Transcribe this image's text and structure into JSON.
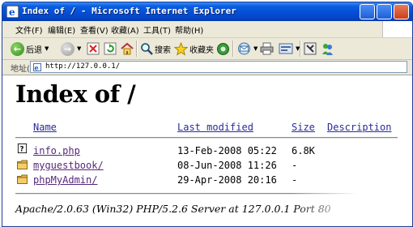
{
  "window": {
    "title": "Index of / - Microsoft Internet Explorer"
  },
  "menu": {
    "items": [
      "文件(F)",
      "编辑(E)",
      "查看(V)",
      "收藏(A)",
      "工具(T)",
      "帮助(H)"
    ]
  },
  "toolbar": {
    "back_label": "后退",
    "search_label": "搜索",
    "favorites_label": "收藏夹"
  },
  "address": {
    "label": "地址(D)",
    "url": "http://127.0.0.1/"
  },
  "page": {
    "heading": "Index of /",
    "columns": {
      "name": "Name",
      "modified": "Last modified",
      "size": "Size",
      "description": "Description"
    },
    "rows": [
      {
        "icon": "unknown-file-icon",
        "name": "info.php",
        "modified": "13-Feb-2008 05:22",
        "size": "6.8K"
      },
      {
        "icon": "folder-icon",
        "name": "myguestbook/",
        "modified": "08-Jun-2008 11:26",
        "size": "-"
      },
      {
        "icon": "folder-icon",
        "name": "phpMyAdmin/",
        "modified": "29-Apr-2008 20:16",
        "size": "-"
      }
    ],
    "server_signature": "Apache/2.0.63 (Win32) PHP/5.2.6 Server at 127.0.0.1 Port 80"
  },
  "colors": {
    "link_visited": "#56287a",
    "link_header": "#2a2a9a",
    "titlebar": "#0550d8"
  }
}
